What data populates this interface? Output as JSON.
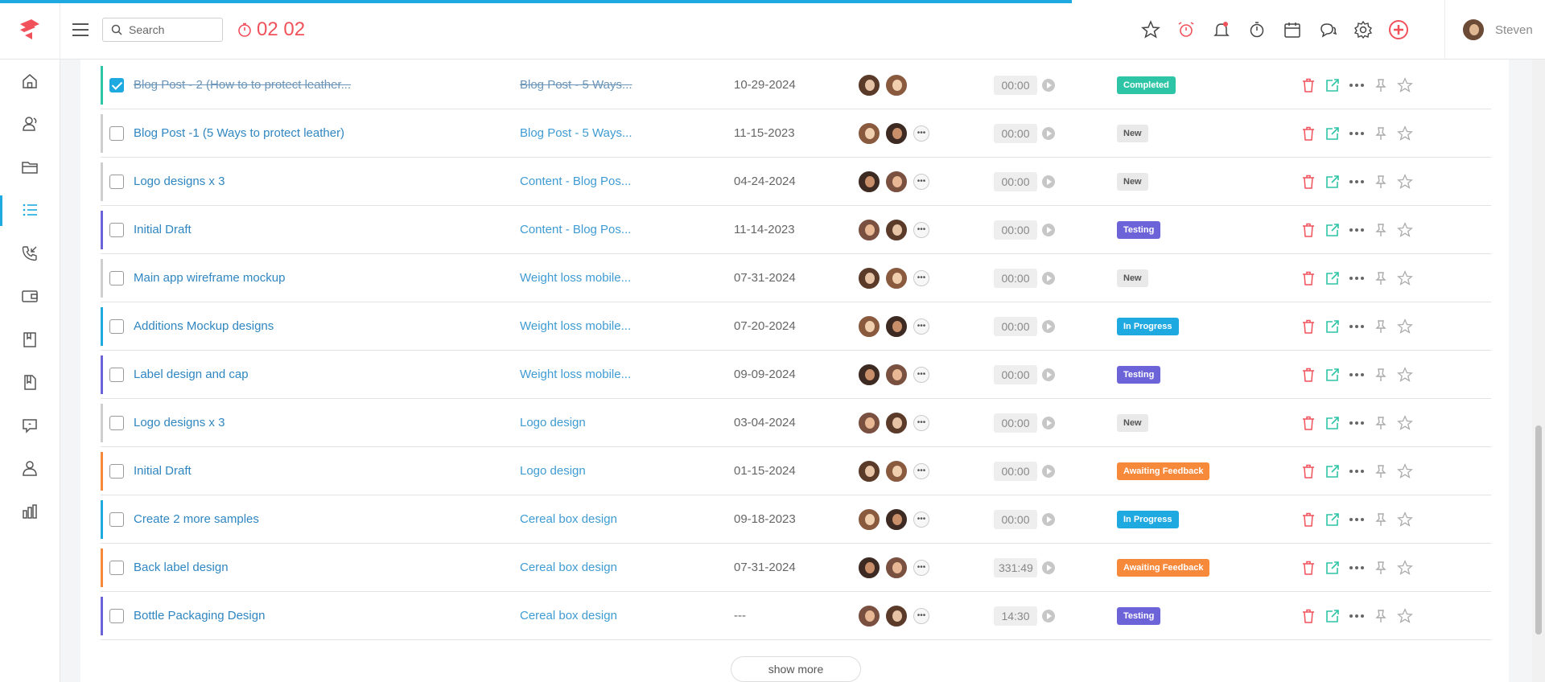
{
  "header": {
    "search_placeholder": "Search",
    "timer": "02 02",
    "user_name": "Steven",
    "icons": [
      "star-icon",
      "alarm-icon",
      "bell-icon",
      "stopwatch-icon",
      "calendar-icon",
      "chat-icon",
      "gear-icon",
      "add-circle-icon"
    ]
  },
  "sidebar": {
    "items": [
      "home-icon",
      "contacts-icon",
      "folder-icon",
      "list-icon",
      "phone-icon",
      "wallet-icon",
      "book-icon",
      "file-icon",
      "support-icon",
      "user-icon",
      "chart-icon"
    ],
    "active": "list-icon"
  },
  "tasks": [
    {
      "name": "Blog Post - 2 (How to to protect leather...",
      "project": "Blog Post - 5 Ways...",
      "date": "10-29-2024",
      "time": "00:00",
      "status": "Completed",
      "status_color": "#2ec4a6",
      "bar": "#2ec4a6",
      "checked": true,
      "avatars": 2
    },
    {
      "name": "Blog Post -1 (5 Ways to protect leather)",
      "project": "Blog Post - 5 Ways...",
      "date": "11-15-2023",
      "time": "00:00",
      "status": "New",
      "status_color": "#e9e9e9",
      "bar": "#cfcfcf",
      "checked": false,
      "avatars": 3
    },
    {
      "name": "Logo designs x 3",
      "project": "Content - Blog Pos...",
      "date": "04-24-2024",
      "time": "00:00",
      "status": "New",
      "status_color": "#e9e9e9",
      "bar": "#cfcfcf",
      "checked": false,
      "avatars": 3
    },
    {
      "name": "Initial Draft",
      "project": "Content - Blog Pos...",
      "date": "11-14-2023",
      "time": "00:00",
      "status": "Testing",
      "status_color": "#6c63d9",
      "bar": "#6c63d9",
      "checked": false,
      "avatars": 3
    },
    {
      "name": "Main app wireframe mockup",
      "project": "Weight loss mobile...",
      "date": "07-31-2024",
      "time": "00:00",
      "status": "New",
      "status_color": "#e9e9e9",
      "bar": "#cfcfcf",
      "checked": false,
      "avatars": 3
    },
    {
      "name": "Additions Mockup designs",
      "project": "Weight loss mobile...",
      "date": "07-20-2024",
      "time": "00:00",
      "status": "In Progress",
      "status_color": "#1fa9e1",
      "bar": "#1fa9e1",
      "checked": false,
      "avatars": 3
    },
    {
      "name": "Label design and cap",
      "project": "Weight loss mobile...",
      "date": "09-09-2024",
      "time": "00:00",
      "status": "Testing",
      "status_color": "#6c63d9",
      "bar": "#6c63d9",
      "checked": false,
      "avatars": 3
    },
    {
      "name": "Logo designs x 3",
      "project": "Logo design",
      "date": "03-04-2024",
      "time": "00:00",
      "status": "New",
      "status_color": "#e9e9e9",
      "bar": "#cfcfcf",
      "checked": false,
      "avatars": 3
    },
    {
      "name": "Initial Draft",
      "project": "Logo design",
      "date": "01-15-2024",
      "time": "00:00",
      "status": "Awaiting Feedback",
      "status_color": "#f7893b",
      "bar": "#f7893b",
      "checked": false,
      "avatars": 3
    },
    {
      "name": "Create 2 more samples",
      "project": "Cereal box design",
      "date": "09-18-2023",
      "time": "00:00",
      "status": "In Progress",
      "status_color": "#1fa9e1",
      "bar": "#1fa9e1",
      "checked": false,
      "avatars": 3
    },
    {
      "name": "Back label design",
      "project": "Cereal box design",
      "date": "07-31-2024",
      "time": "331:49",
      "status": "Awaiting Feedback",
      "status_color": "#f7893b",
      "bar": "#f7893b",
      "checked": false,
      "avatars": 3
    },
    {
      "name": "Bottle Packaging Design",
      "project": "Cereal box design",
      "date": "---",
      "time": "14:30",
      "status": "Testing",
      "status_color": "#6c63d9",
      "bar": "#6c63d9",
      "checked": false,
      "avatars": 3
    }
  ],
  "show_more_label": "show more",
  "colors": {
    "accent": "#1fa9e1",
    "timer": "#f0515b",
    "delete": "#f0515b",
    "open": "#2ec4a6"
  }
}
